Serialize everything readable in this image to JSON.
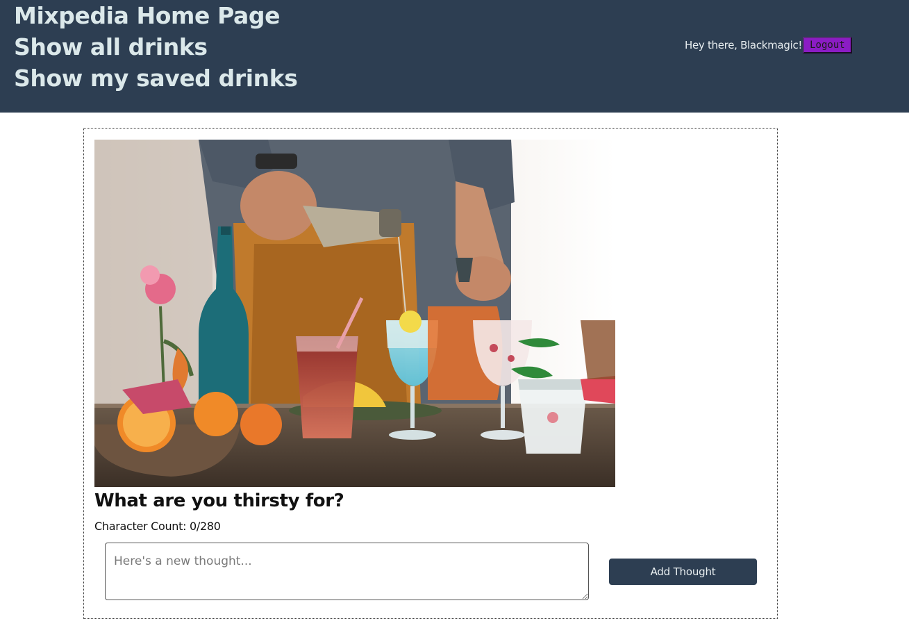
{
  "nav": {
    "home": "Mixpedia Home Page",
    "all_drinks": "Show all drinks",
    "saved_drinks": "Show my saved drinks"
  },
  "user": {
    "greeting": "Hey there, Blackmagic!",
    "logout_label": "Logout"
  },
  "hero": {
    "alt": "Bartender pouring a cocktail over a table of colorful drinks"
  },
  "prompt": {
    "title": "What are you thirsty for?",
    "char_count": "Character Count: 0/280",
    "placeholder": "Here's a new thought...",
    "value": "",
    "submit_label": "Add Thought"
  },
  "colors": {
    "header_bg": "#2d3e52",
    "nav_text": "#dbe8ea",
    "logout_bg": "#8b1cc4",
    "button_bg": "#2d3e52"
  }
}
